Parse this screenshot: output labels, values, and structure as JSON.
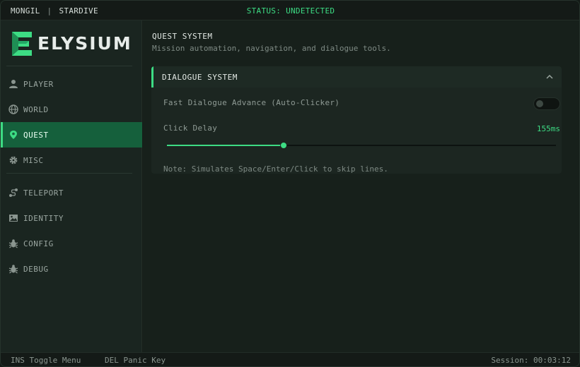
{
  "topbar": {
    "user": "MONGIL",
    "separator": "|",
    "server": "STARDIVE",
    "status": "STATUS: UNDETECTED"
  },
  "brand": {
    "name": "ELYSIUM",
    "logo_letter": "E",
    "accent": "#3ddc84"
  },
  "sidebar": {
    "items": [
      {
        "label": "PLAYER",
        "icon": "user-icon"
      },
      {
        "label": "WORLD",
        "icon": "globe-icon"
      },
      {
        "label": "QUEST",
        "icon": "map-pin-icon",
        "active": true
      },
      {
        "label": "MISC",
        "icon": "gear-icon"
      },
      {
        "label": "TELEPORT",
        "icon": "route-icon"
      },
      {
        "label": "IDENTITY",
        "icon": "image-icon"
      },
      {
        "label": "CONFIG",
        "icon": "bug-icon"
      },
      {
        "label": "DEBUG",
        "icon": "bug-icon"
      }
    ]
  },
  "page": {
    "title": "QUEST SYSTEM",
    "subtitle": "Mission automation, navigation, and dialogue tools."
  },
  "panel": {
    "title": "DIALOGUE SYSTEM",
    "toggle_label": "Fast Dialogue Advance (Auto-Clicker)",
    "toggle_on": false,
    "slider_label": "Click Delay",
    "slider_value": "155ms",
    "slider_fraction": 0.3,
    "note": "Note: Simulates Space/Enter/Click to skip lines."
  },
  "footer": {
    "toggle_key": "INS Toggle Menu",
    "panic_key": "DEL Panic Key",
    "session": "Session: 00:03:12"
  }
}
